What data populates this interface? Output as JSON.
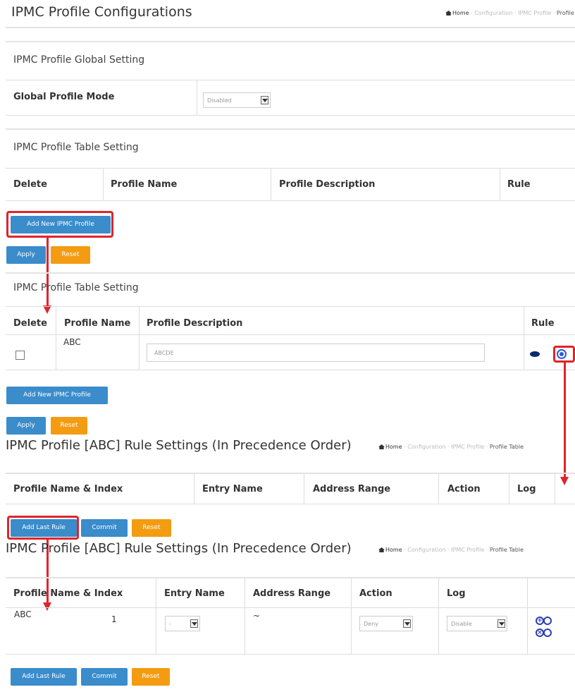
{
  "page": {
    "title": "IPMC Profile Configurations",
    "breadcrumb": [
      "Home",
      "Configuration",
      "IPMC Profile",
      "Profile Table"
    ]
  },
  "global_setting": {
    "heading": "IPMC Profile Global Setting",
    "mode_label": "Global Profile Mode",
    "mode_value": "Disabled"
  },
  "table_setting_1": {
    "heading": "IPMC Profile Table Setting",
    "columns": [
      "Delete",
      "Profile Name",
      "Profile Description",
      "Rule"
    ]
  },
  "buttons": {
    "add_profile": "Add New IPMC Profile",
    "apply": "Apply",
    "reset": "Reset",
    "add_last_rule": "Add Last Rule",
    "commit": "Commit"
  },
  "table_setting_2": {
    "heading": "IPMC Profile Table Setting",
    "columns": [
      "Delete",
      "Profile Name",
      "Profile Description",
      "Rule"
    ],
    "row": {
      "name": "ABC",
      "description": "ABCDE"
    }
  },
  "rule_settings_1": {
    "title": "IPMC Profile [ABC] Rule Settings (In Precedence Order)",
    "columns": [
      "Profile Name & Index",
      "Entry Name",
      "Address Range",
      "Action",
      "Log"
    ]
  },
  "rule_settings_2": {
    "title": "IPMC Profile [ABC] Rule Settings (In Precedence Order)",
    "columns": [
      "Profile Name & Index",
      "Entry Name",
      "Address Range",
      "Action",
      "Log"
    ],
    "row": {
      "name": "ABC",
      "index": "1",
      "entry": "-",
      "range": "~",
      "action": "Deny",
      "log": "Disable"
    }
  },
  "colors": {
    "accent_blue": "#3a8ccb",
    "accent_orange": "#f39c12",
    "highlight_red": "#e0242b"
  }
}
